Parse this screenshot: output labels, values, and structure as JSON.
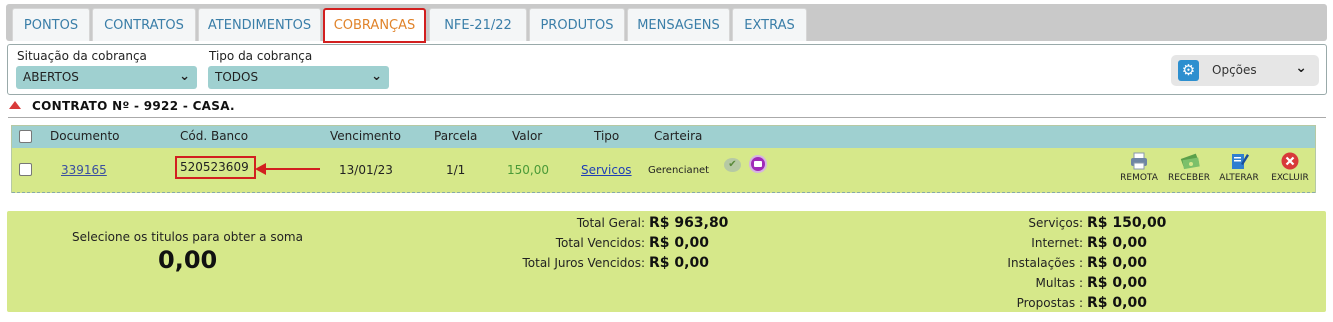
{
  "tabs": [
    "PONTOS",
    "CONTRATOS",
    "ATENDIMENTOS",
    "COBRANÇAS",
    "NFE-21/22",
    "PRODUTOS",
    "MENSAGENS",
    "EXTRAS"
  ],
  "active_tab": "COBRANÇAS",
  "filters": {
    "situacao_label": "Situação da cobrança",
    "situacao_value": "ABERTOS",
    "tipo_label": "Tipo da cobrança",
    "tipo_value": "TODOS",
    "options_label": "Opções"
  },
  "contract": {
    "title": "CONTRATO Nº - 9922 - CASA."
  },
  "table": {
    "headers": [
      "Documento",
      "Cód. Banco",
      "Vencimento",
      "Parcela",
      "Valor",
      "Tipo",
      "Carteira"
    ],
    "row": {
      "documento": "339165",
      "cod_banco": "520523609",
      "vencimento": "13/01/23",
      "parcela": "1/1",
      "valor": "150,00",
      "tipo": "Servicos",
      "carteira": "Gerencianet"
    },
    "actions": [
      "REMOTA",
      "RECEBER",
      "ALTERAR",
      "EXCLUIR"
    ]
  },
  "summary": {
    "hint": "Selecione os titulos para obter a soma",
    "selected_total": "0,00",
    "totals": [
      {
        "label": "Total Geral:",
        "value": "R$ 963,80"
      },
      {
        "label": "Total Vencidos:",
        "value": "R$ 0,00"
      },
      {
        "label": "Total Juros Vencidos:",
        "value": "R$ 0,00"
      }
    ],
    "categories": [
      {
        "label": "Serviços:",
        "value": "R$ 150,00"
      },
      {
        "label": "Internet:",
        "value": "R$ 0,00"
      },
      {
        "label": "Instalações :",
        "value": "R$ 0,00"
      },
      {
        "label": "Multas :",
        "value": "R$ 0,00"
      },
      {
        "label": "Propostas :",
        "value": "R$ 0,00"
      }
    ]
  },
  "colors": {
    "tab_text": "#3a7ea8",
    "active_tab_text": "#e0832a",
    "highlight_red": "#d21f1f",
    "header_teal": "#9fd0d0",
    "row_green": "#d6e88a",
    "valor_green": "#4a9a37"
  }
}
